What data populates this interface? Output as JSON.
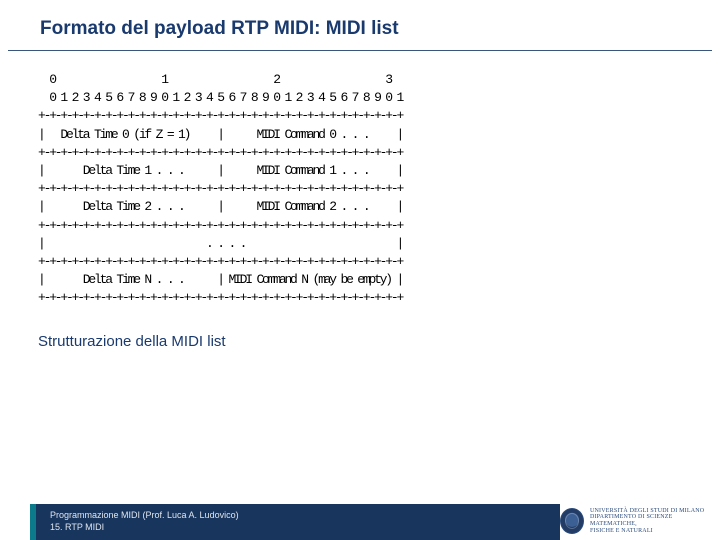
{
  "title": "Formato del payload RTP MIDI: MIDI list",
  "diagram": {
    "lines": [
      "  0                   1                   2                   3",
      "  0 1 2 3 4 5 6 7 8 9 0 1 2 3 4 5 6 7 8 9 0 1 2 3 4 5 6 7 8 9 0 1",
      "+-+-+-+-+-+-+-+-+-+-+-+-+-+-+-+-+-+-+-+-+-+-+-+-+-+-+-+-+-+-+-+-+",
      "|   Delta Time 0 (if Z = 1)     |      MIDI Command 0 . . .     |",
      "+-+-+-+-+-+-+-+-+-+-+-+-+-+-+-+-+-+-+-+-+-+-+-+-+-+-+-+-+-+-+-+-+",
      "|       Delta Time 1 . . .      |      MIDI Command 1 . . .     |",
      "+-+-+-+-+-+-+-+-+-+-+-+-+-+-+-+-+-+-+-+-+-+-+-+-+-+-+-+-+-+-+-+-+",
      "|       Delta Time 2 . . .      |      MIDI Command 2 . . .     |",
      "+-+-+-+-+-+-+-+-+-+-+-+-+-+-+-+-+-+-+-+-+-+-+-+-+-+-+-+-+-+-+-+-+",
      "|                             . . . .                           |",
      "+-+-+-+-+-+-+-+-+-+-+-+-+-+-+-+-+-+-+-+-+-+-+-+-+-+-+-+-+-+-+-+-+",
      "|       Delta Time N . . .      | MIDI Command N (may be empty) |",
      "+-+-+-+-+-+-+-+-+-+-+-+-+-+-+-+-+-+-+-+-+-+-+-+-+-+-+-+-+-+-+-+-+"
    ]
  },
  "subtitle": "Strutturazione della MIDI list",
  "footer": {
    "line1": "Programmazione MIDI (Prof. Luca A. Ludovico)",
    "line2": "15. RTP MIDI"
  },
  "logo": {
    "line1": "Università degli Studi di Milano",
    "line2": "Dipartimento di Scienze Matematiche,",
    "line3": "Fisiche e Naturali"
  }
}
